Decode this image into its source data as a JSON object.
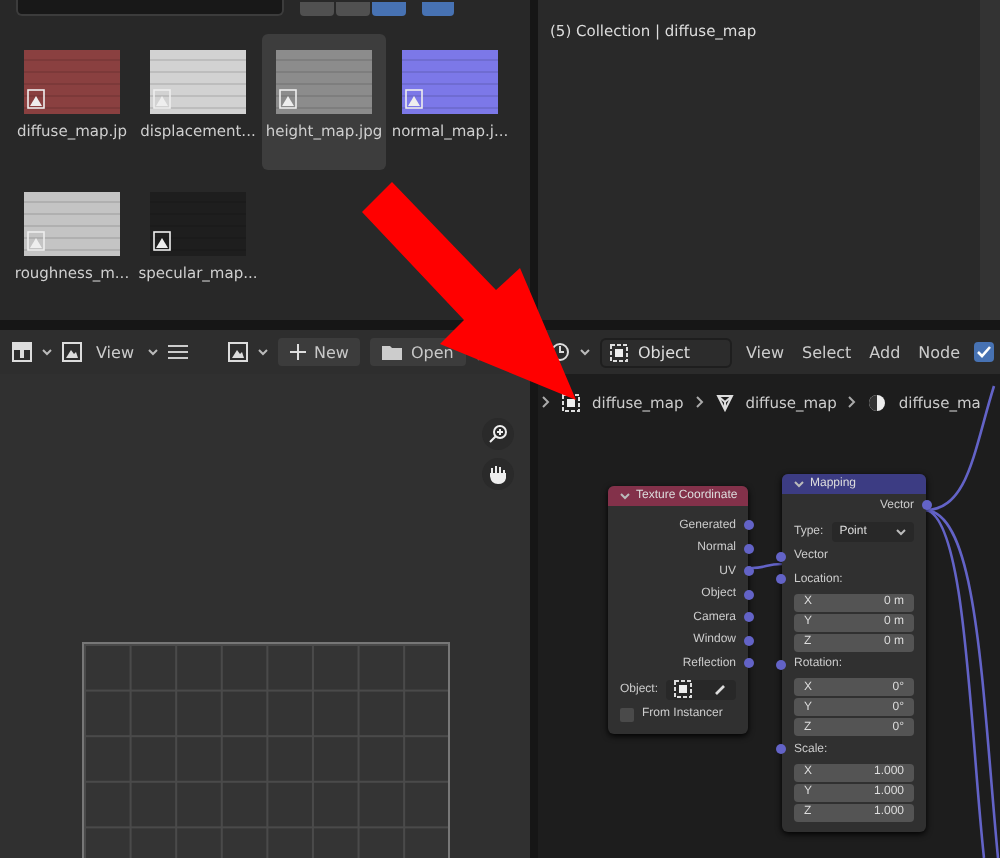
{
  "file_browser": {
    "view_modes": [
      {
        "selected": false
      },
      {
        "selected": false
      },
      {
        "selected": true
      }
    ],
    "files": [
      {
        "name": "diffuse_map.jp",
        "color": "#8a4040",
        "selected": false
      },
      {
        "name": "displacement...",
        "color": "#d2d2d2",
        "selected": false
      },
      {
        "name": "height_map.jpg",
        "color": "#8c8c8c",
        "selected": true
      },
      {
        "name": "normal_map.j...",
        "color": "#7c78e8",
        "selected": false
      },
      {
        "name": "roughness_m...",
        "color": "#c4c4c4",
        "selected": false
      },
      {
        "name": "specular_map...",
        "color": "#1e1e1e",
        "selected": false
      }
    ]
  },
  "viewport": {
    "info": "(5) Collection | diffuse_map"
  },
  "image_editor": {
    "menus": [
      "View"
    ],
    "buttons": [
      {
        "label": "New",
        "kind": "add"
      },
      {
        "label": "Open",
        "kind": "folder"
      }
    ]
  },
  "node_editor": {
    "mode": "Object",
    "menus": [
      "View",
      "Select",
      "Add",
      "Node"
    ],
    "use_nodes": true,
    "breadcrumbs": [
      {
        "label": "diffuse_map",
        "kind": "object"
      },
      {
        "label": "diffuse_map",
        "kind": "mesh"
      },
      {
        "label": "diffuse_ma",
        "kind": "material"
      }
    ],
    "texture_coordinate": {
      "title": "Texture Coordinate",
      "outputs": [
        "Generated",
        "Normal",
        "UV",
        "Object",
        "Camera",
        "Window",
        "Reflection"
      ],
      "object_label": "Object:",
      "from_instancer": {
        "label": "From Instancer",
        "checked": false
      }
    },
    "mapping": {
      "title": "Mapping",
      "output": "Vector",
      "type_label": "Type:",
      "type_value": "Point",
      "input": "Vector",
      "groups": [
        {
          "label": "Location:",
          "fields": [
            {
              "axis": "X",
              "value": "0 m"
            },
            {
              "axis": "Y",
              "value": "0 m"
            },
            {
              "axis": "Z",
              "value": "0 m"
            }
          ]
        },
        {
          "label": "Rotation:",
          "fields": [
            {
              "axis": "X",
              "value": "0°"
            },
            {
              "axis": "Y",
              "value": "0°"
            },
            {
              "axis": "Z",
              "value": "0°"
            }
          ]
        },
        {
          "label": "Scale:",
          "fields": [
            {
              "axis": "X",
              "value": "1.000"
            },
            {
              "axis": "Y",
              "value": "1.000"
            },
            {
              "axis": "Z",
              "value": "1.000"
            }
          ]
        }
      ]
    }
  }
}
